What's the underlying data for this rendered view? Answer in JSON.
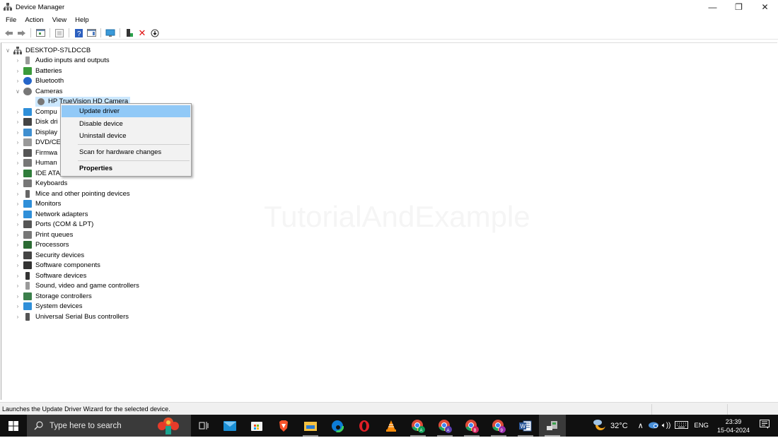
{
  "window": {
    "title": "Device Manager",
    "controls": {
      "minimize": "—",
      "restore": "❐",
      "close": "✕"
    }
  },
  "menu": [
    "File",
    "Action",
    "View",
    "Help"
  ],
  "toolbar": {
    "icons": [
      "back-icon",
      "forward-icon",
      "show-hide-console-tree-icon",
      "properties-icon",
      "help-icon",
      "action-pane-icon",
      "scan-monitor-icon",
      "enable-device-icon",
      "uninstall-icon",
      "update-driver-icon"
    ]
  },
  "tree": {
    "root": "DESKTOP-S7LDCCB",
    "categories": [
      {
        "label": "Audio inputs and outputs",
        "icon": "speaker-icon",
        "expanded": false
      },
      {
        "label": "Batteries",
        "icon": "battery-icon",
        "expanded": false
      },
      {
        "label": "Bluetooth",
        "icon": "bluetooth-icon",
        "expanded": false
      },
      {
        "label": "Cameras",
        "icon": "camera-icon",
        "expanded": true,
        "children": [
          "HP TrueVision HD Camera"
        ]
      },
      {
        "label": "Computer",
        "visible": "Compu",
        "icon": "computer-icon",
        "expanded": false
      },
      {
        "label": "Disk drives",
        "visible": "Disk dri",
        "icon": "disk-icon",
        "expanded": false
      },
      {
        "label": "Display adapters",
        "visible": "Display",
        "icon": "display-adapter-icon",
        "expanded": false
      },
      {
        "label": "DVD/CD-ROM drives",
        "visible": "DVD/CE",
        "icon": "dvd-icon",
        "expanded": false
      },
      {
        "label": "Firmware",
        "visible": "Firmwa",
        "icon": "firmware-icon",
        "expanded": false
      },
      {
        "label": "Human Interface Devices",
        "visible": "Human",
        "icon": "hid-icon",
        "expanded": false
      },
      {
        "label": "IDE ATA/ATAPI controllers",
        "visible": "IDE ATA",
        "icon": "ide-icon",
        "expanded": false
      },
      {
        "label": "Keyboards",
        "icon": "keyboard-icon",
        "expanded": false
      },
      {
        "label": "Mice and other pointing devices",
        "icon": "mouse-icon",
        "expanded": false
      },
      {
        "label": "Monitors",
        "icon": "monitor-icon",
        "expanded": false
      },
      {
        "label": "Network adapters",
        "icon": "network-icon",
        "expanded": false
      },
      {
        "label": "Ports (COM & LPT)",
        "icon": "port-icon",
        "expanded": false
      },
      {
        "label": "Print queues",
        "icon": "printer-icon",
        "expanded": false
      },
      {
        "label": "Processors",
        "icon": "processor-icon",
        "expanded": false
      },
      {
        "label": "Security devices",
        "icon": "security-icon",
        "expanded": false
      },
      {
        "label": "Software components",
        "icon": "software-component-icon",
        "expanded": false
      },
      {
        "label": "Software devices",
        "icon": "software-device-icon",
        "expanded": false
      },
      {
        "label": "Sound, video and game controllers",
        "icon": "sound-icon",
        "expanded": false
      },
      {
        "label": "Storage controllers",
        "icon": "storage-icon",
        "expanded": false
      },
      {
        "label": "System devices",
        "icon": "system-icon",
        "expanded": false
      },
      {
        "label": "Universal Serial Bus controllers",
        "icon": "usb-icon",
        "expanded": false
      }
    ],
    "selected": "HP TrueVision HD Camera"
  },
  "context_menu": {
    "items": [
      {
        "label": "Update driver",
        "highlighted": true
      },
      {
        "label": "Disable device"
      },
      {
        "label": "Uninstall device"
      },
      {
        "label": "Scan for hardware changes"
      },
      {
        "label": "Properties",
        "bold": true
      }
    ]
  },
  "watermark": "TutorialAndExample",
  "statusbar": {
    "text": "Launches the Update Driver Wizard for the selected device."
  },
  "taskbar": {
    "search_placeholder": "Type here to search",
    "apps": [
      "task-view",
      "mail",
      "microsoft-store",
      "brave",
      "file-explorer",
      "edge",
      "opera",
      "vlc",
      "chrome-profile-a-green",
      "chrome-profile-a-purple",
      "chrome-profile-b",
      "chrome-profile-9",
      "word",
      "device-manager"
    ],
    "weather": "32°C",
    "language": "ENG",
    "time": "23:39",
    "date": "15-04-2024"
  },
  "colors": {
    "selection": "#cce8ff",
    "menu_highlight": "#91c9f7",
    "taskbar": "#101010",
    "searchbox": "#3a3a3a"
  }
}
